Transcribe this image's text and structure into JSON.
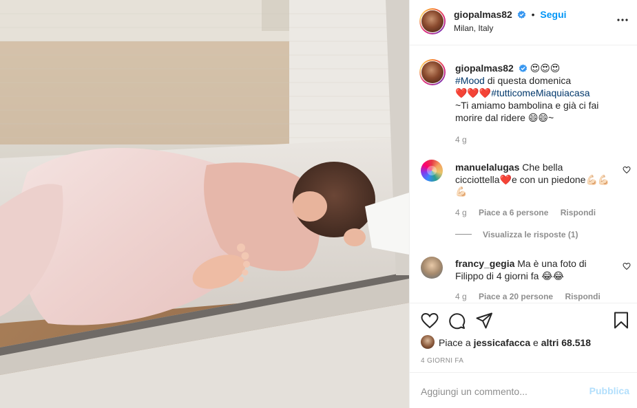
{
  "post": {
    "username": "giopalmas82",
    "follow_label": "Segui",
    "location": "Milan, Italy",
    "more_label": "•••"
  },
  "caption": {
    "username": "giopalmas82",
    "emoji_after_name": "😍😍😍",
    "line1_tag": "#Mood",
    "line1_text": " di questa domenica",
    "line2_hearts": "❤️❤️❤️",
    "line2_tag": "#tutticomeMiaquiacasa",
    "line3": "~Ti amiamo bambolina e già ci fai",
    "line4": "morire dal ridere 😄😄~",
    "age": "4 g"
  },
  "comments": [
    {
      "username": "manuelalugas",
      "line1": "Che bella",
      "line2": "cicciottella❤️e con un piedone💪🏻💪🏻",
      "line3": "💪🏻",
      "age": "4 g",
      "likes": "Piace a 6 persone",
      "reply": "Rispondi",
      "view_replies": "Visualizza le risposte (1)"
    },
    {
      "username": "francy_gegia",
      "line1": "Ma è una foto di",
      "line2": "Filippo di 4 giorni fa 😂😂",
      "age": "4 g",
      "likes": "Piace a 20 persone",
      "reply": "Rispondi"
    }
  ],
  "likes": {
    "prefix": "Piace a ",
    "user": "jessicafacca",
    "middle": " e ",
    "others": "altri 68.518"
  },
  "time_ago": "4 GIORNI FA",
  "comment_box": {
    "placeholder": "Aggiungi un commento...",
    "publish_label": "Pubblica"
  },
  "icons": {
    "like": "heart-icon",
    "comment": "comment-icon",
    "share": "share-icon",
    "save": "bookmark-icon",
    "verified": "verified-badge-icon",
    "more": "more-options-icon"
  },
  "colors": {
    "link_blue": "#0095f6",
    "hashtag": "#00376b",
    "muted": "#8e8e8e",
    "publish_disabled": "#b2dffc"
  }
}
